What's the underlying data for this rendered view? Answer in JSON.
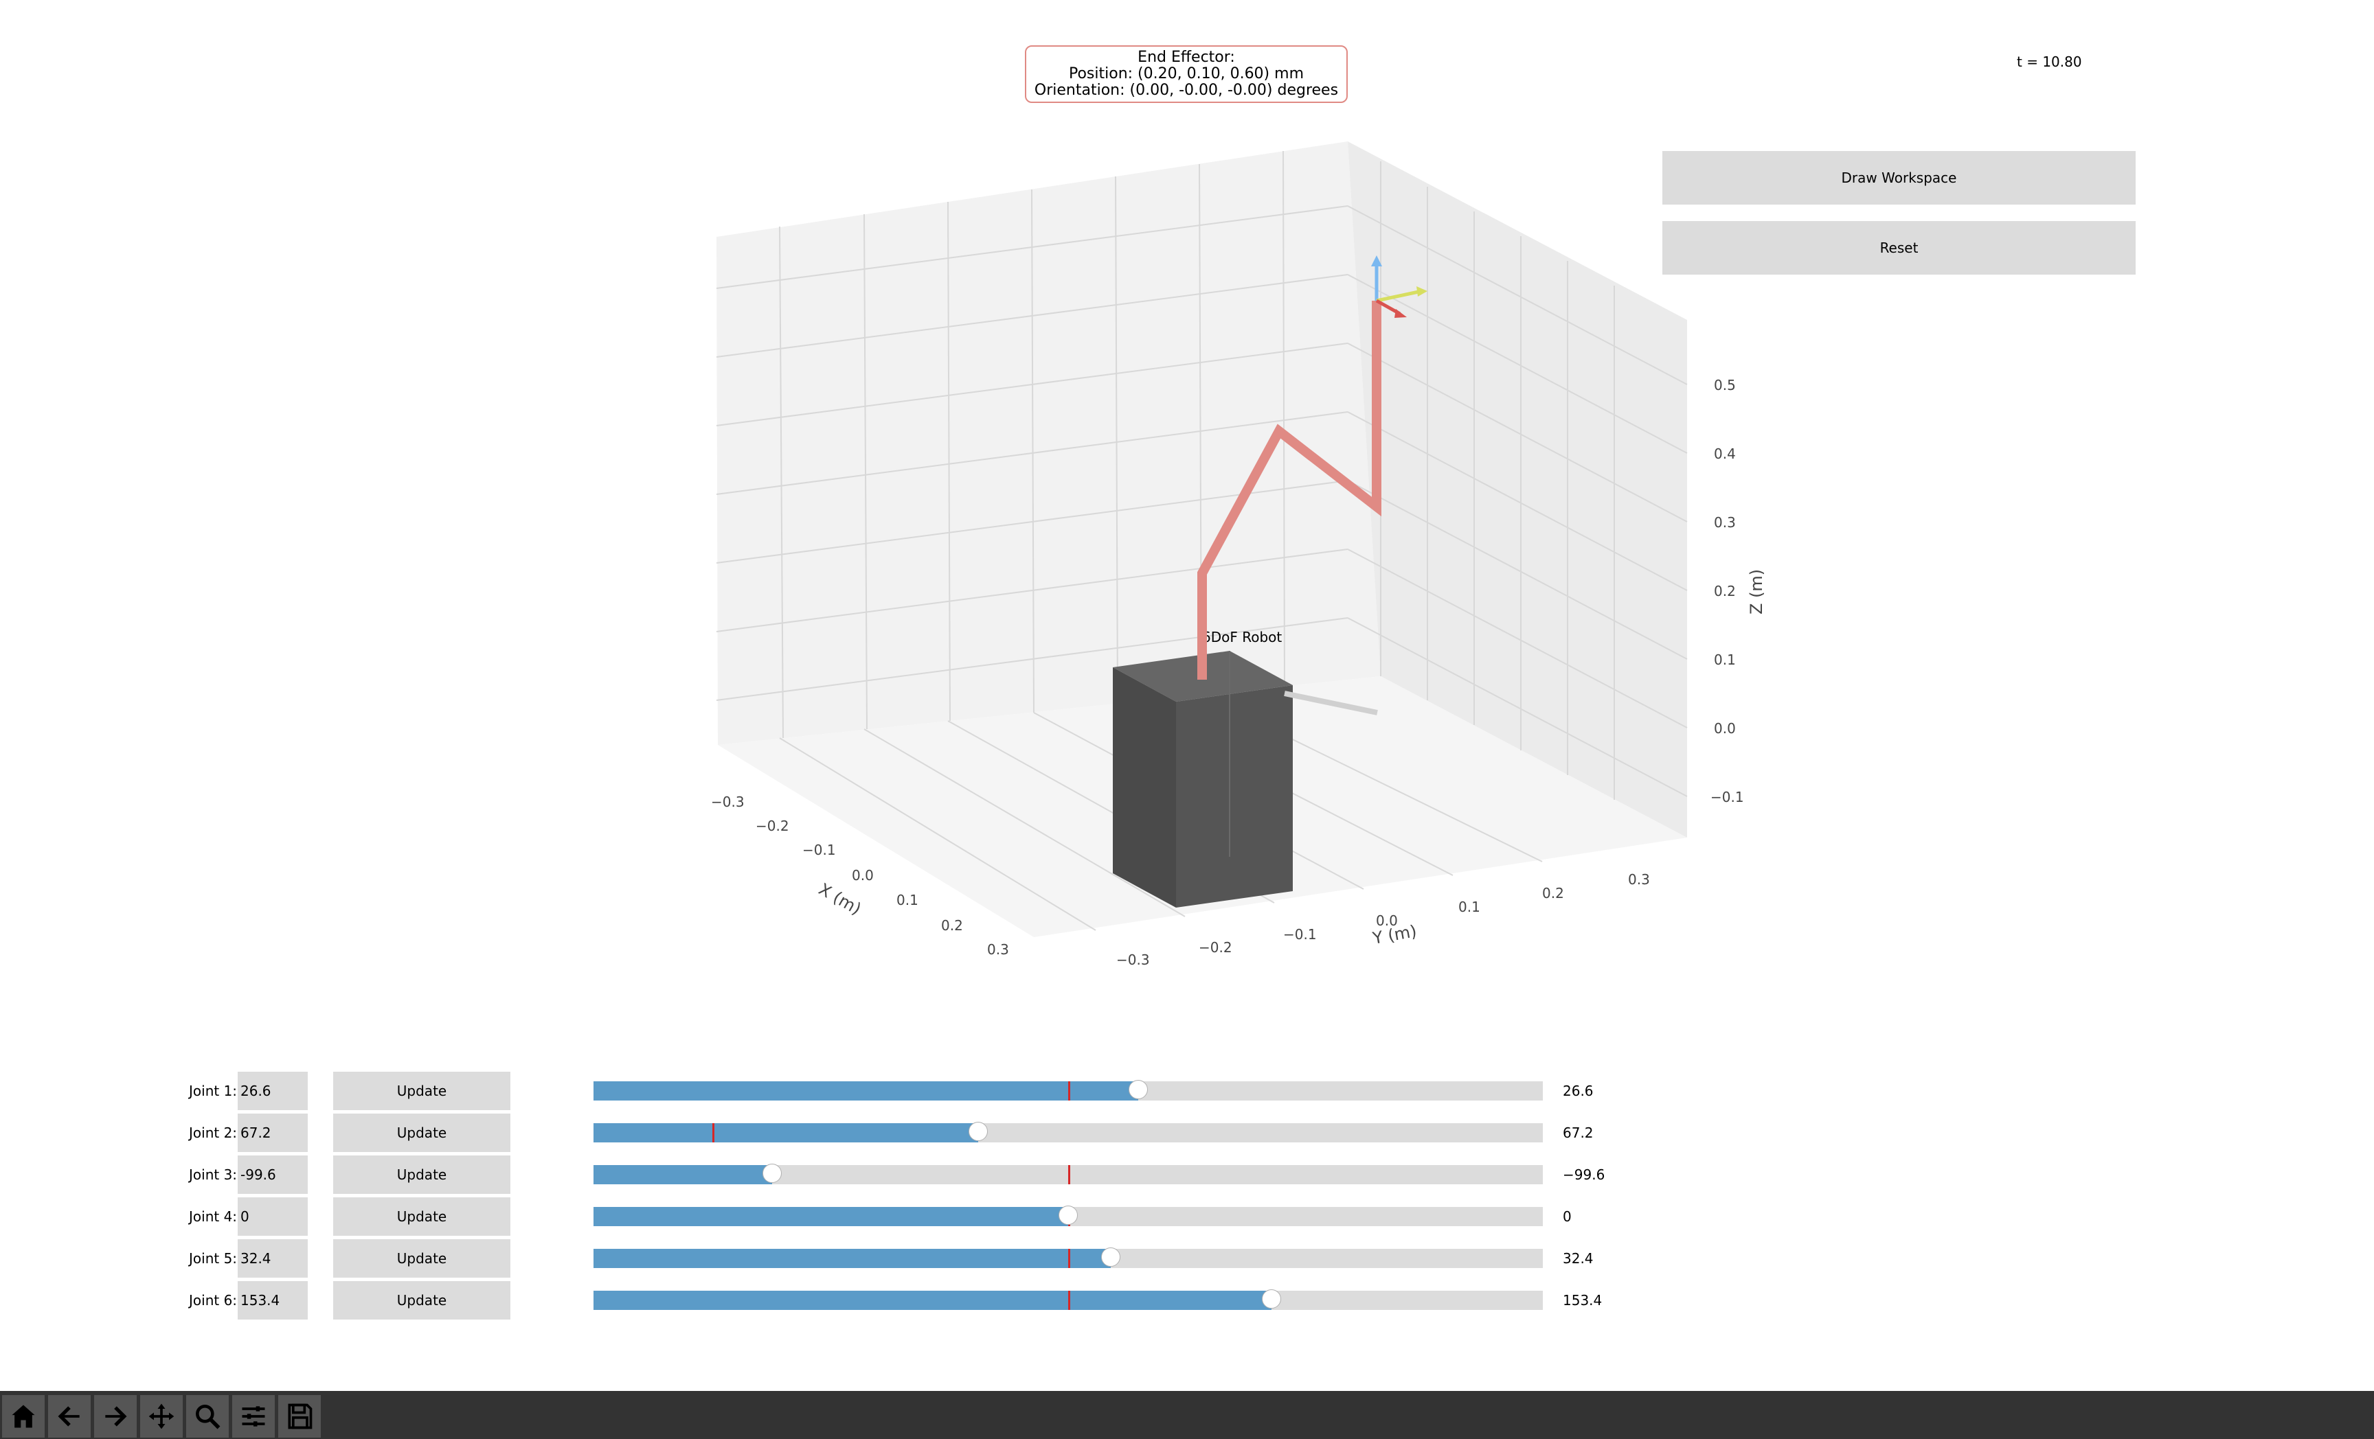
{
  "end_effector": {
    "title": "End Effector:",
    "position": "Position: (0.20, 0.10, 0.60) mm",
    "orientation": "Orientation: (0.00, -0.00, -0.00) degrees"
  },
  "time_label": "t = 10.80",
  "buttons": {
    "draw_workspace": "Draw Workspace",
    "reset": "Reset"
  },
  "plot": {
    "robot_label": "6DoF Robot",
    "x_axis_label": "X (m)",
    "y_axis_label": "Y (m)",
    "z_axis_label": "Z (m)",
    "x_ticks": [
      "−0.3",
      "−0.2",
      "−0.1",
      "0.0",
      "0.1",
      "0.2",
      "0.3"
    ],
    "y_ticks": [
      "−0.3",
      "−0.2",
      "−0.1",
      "0.0",
      "0.1",
      "0.2",
      "0.3"
    ],
    "z_ticks": [
      "−0.1",
      "0.0",
      "0.1",
      "0.2",
      "0.3",
      "0.4",
      "0.5"
    ],
    "arm_color": "#e08a84",
    "base_color": "#555555"
  },
  "joints": [
    {
      "label": "Joint 1:",
      "input": "26.6",
      "update": "Update",
      "value": "26.6",
      "fraction": 0.574,
      "init_fraction": 0.5
    },
    {
      "label": "Joint 2:",
      "input": "67.2",
      "update": "Update",
      "value": "67.2",
      "fraction": 0.405,
      "init_fraction": 0.125
    },
    {
      "label": "Joint 3:",
      "input": "-99.6",
      "update": "Update",
      "value": "−99.6",
      "fraction": 0.188,
      "init_fraction": 0.5
    },
    {
      "label": "Joint 4:",
      "input": "0",
      "update": "Update",
      "value": "0",
      "fraction": 0.5,
      "init_fraction": 0.5
    },
    {
      "label": "Joint 5:",
      "input": "32.4",
      "update": "Update",
      "value": "32.4",
      "fraction": 0.545,
      "init_fraction": 0.5
    },
    {
      "label": "Joint 6:",
      "input": "153.4",
      "update": "Update",
      "value": "153.4",
      "fraction": 0.714,
      "init_fraction": 0.5
    }
  ],
  "colors": {
    "slider_fill": "#5b9bc8",
    "slider_track": "#dcdcdc",
    "init_marker": "#d62728",
    "toolbar_bg": "#333333"
  },
  "toolbar": [
    "home-icon",
    "back-icon",
    "forward-icon",
    "pan-icon",
    "zoom-icon",
    "configure-icon",
    "save-icon"
  ]
}
